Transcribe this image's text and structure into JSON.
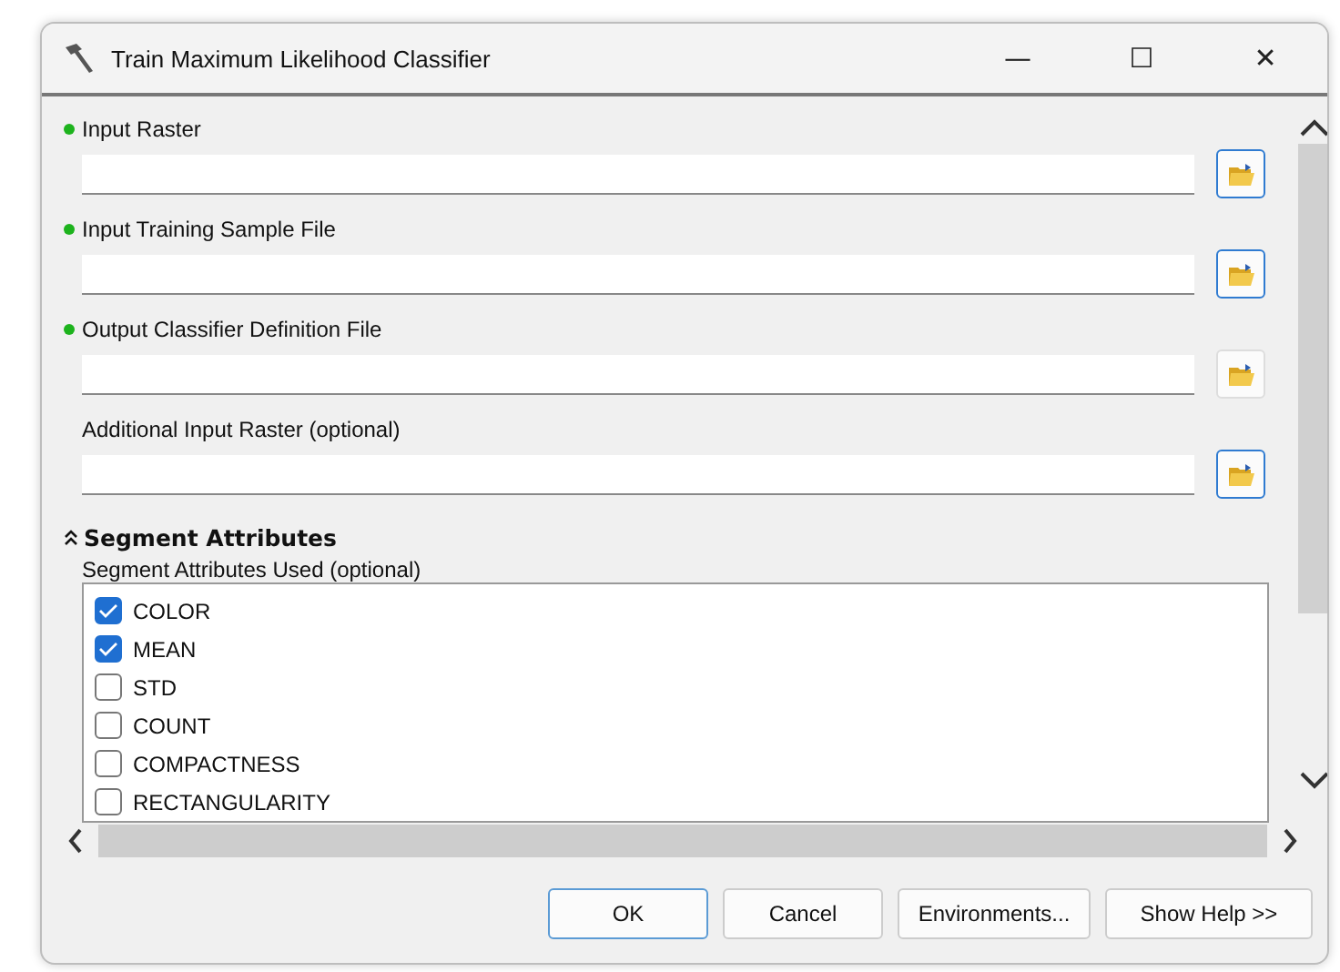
{
  "window": {
    "title": "Train Maximum Likelihood Classifier",
    "controls": [
      "—",
      "☐",
      "✕"
    ]
  },
  "parameters": [
    {
      "label": "Input Raster",
      "required": true,
      "highlighted": true
    },
    {
      "label": "Input Training Sample File",
      "required": true,
      "highlighted": true
    },
    {
      "label": "Output Classifier Definition File",
      "required": true,
      "highlighted": false
    },
    {
      "label": "Additional Input Raster (optional)",
      "required": false,
      "highlighted": true
    }
  ],
  "section": {
    "title": "Segment Attributes",
    "expanded": true,
    "list_label": "Segment Attributes Used (optional)",
    "items": [
      {
        "label": "COLOR",
        "checked": true
      },
      {
        "label": "MEAN",
        "checked": true
      },
      {
        "label": "STD",
        "checked": false
      },
      {
        "label": "COUNT",
        "checked": false
      },
      {
        "label": "COMPACTNESS",
        "checked": false
      },
      {
        "label": "RECTANGULARITY",
        "checked": false
      }
    ]
  },
  "buttons": [
    {
      "label": "OK",
      "default": true
    },
    {
      "label": "Cancel",
      "default": false
    },
    {
      "label": "Environments...",
      "default": false
    },
    {
      "label": "Show Help >>",
      "default": false
    }
  ]
}
